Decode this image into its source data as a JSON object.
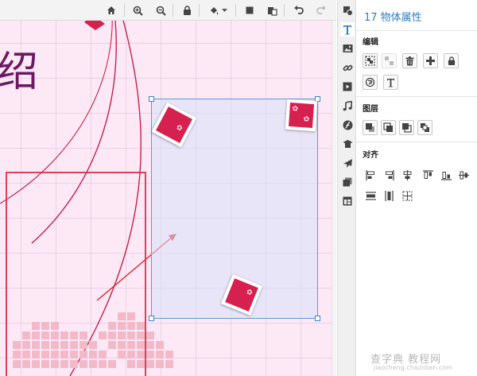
{
  "toolbar": {
    "icons": [
      "home-icon",
      "zoom-in-icon",
      "zoom-out-icon",
      "lock-icon",
      "fill-color-icon",
      "chevron-down-icon",
      "copy-icon",
      "paste-icon",
      "undo-icon",
      "redo-icon"
    ]
  },
  "canvas": {
    "title_text": "绍",
    "accent": "#d6204f",
    "background": "#fde8f6"
  },
  "sidebar_icons": [
    "shape-icon",
    "text-icon",
    "image-icon",
    "link-icon",
    "video-icon",
    "music-icon",
    "flash-icon",
    "pile-icon",
    "plane-icon",
    "layers-icon",
    "layout-icon"
  ],
  "panel": {
    "title": "17 物体属性",
    "sections": {
      "edit": "编辑",
      "layer": "图层",
      "align": "对齐"
    }
  },
  "watermark": {
    "text": "查字典 教程网",
    "url": "jiaocheng.chazidian.com"
  }
}
